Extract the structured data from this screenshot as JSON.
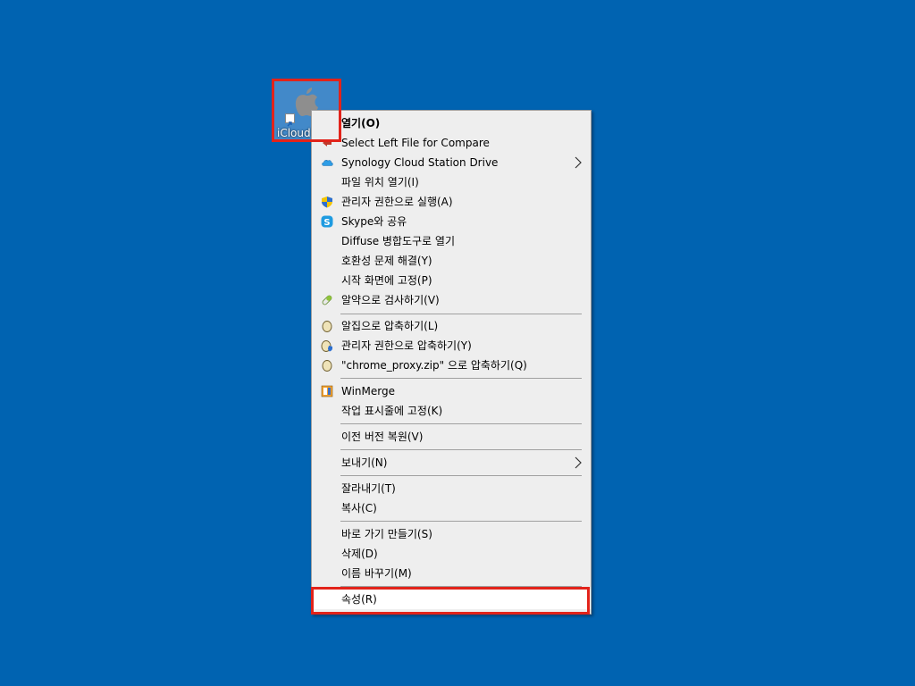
{
  "desktop": {
    "icon_label": "iCloud"
  },
  "menu": {
    "items": [
      {
        "label": "열기(O)"
      },
      {
        "label": "Select Left File for Compare"
      },
      {
        "label": "Synology Cloud Station Drive"
      },
      {
        "label": "파일 위치 열기(I)"
      },
      {
        "label": "관리자 권한으로 실행(A)"
      },
      {
        "label": "Skype와 공유"
      },
      {
        "label": "Diffuse 병합도구로 열기"
      },
      {
        "label": "호환성 문제 해결(Y)"
      },
      {
        "label": "시작 화면에 고정(P)"
      },
      {
        "label": "알약으로 검사하기(V)"
      },
      {
        "label": "알집으로 압축하기(L)"
      },
      {
        "label": "관리자 권한으로 압축하기(Y)"
      },
      {
        "label": "\"chrome_proxy.zip\" 으로 압축하기(Q)"
      },
      {
        "label": "WinMerge"
      },
      {
        "label": "작업 표시줄에 고정(K)"
      },
      {
        "label": "이전 버전 복원(V)"
      },
      {
        "label": "보내기(N)"
      },
      {
        "label": "잘라내기(T)"
      },
      {
        "label": "복사(C)"
      },
      {
        "label": "바로 가기 만들기(S)"
      },
      {
        "label": "삭제(D)"
      },
      {
        "label": "이름 바꾸기(M)"
      },
      {
        "label": "속성(R)"
      }
    ]
  },
  "colors": {
    "desktop_bg": "#0063b1",
    "menu_bg": "#eeeeee",
    "highlight": "#e2231a"
  }
}
